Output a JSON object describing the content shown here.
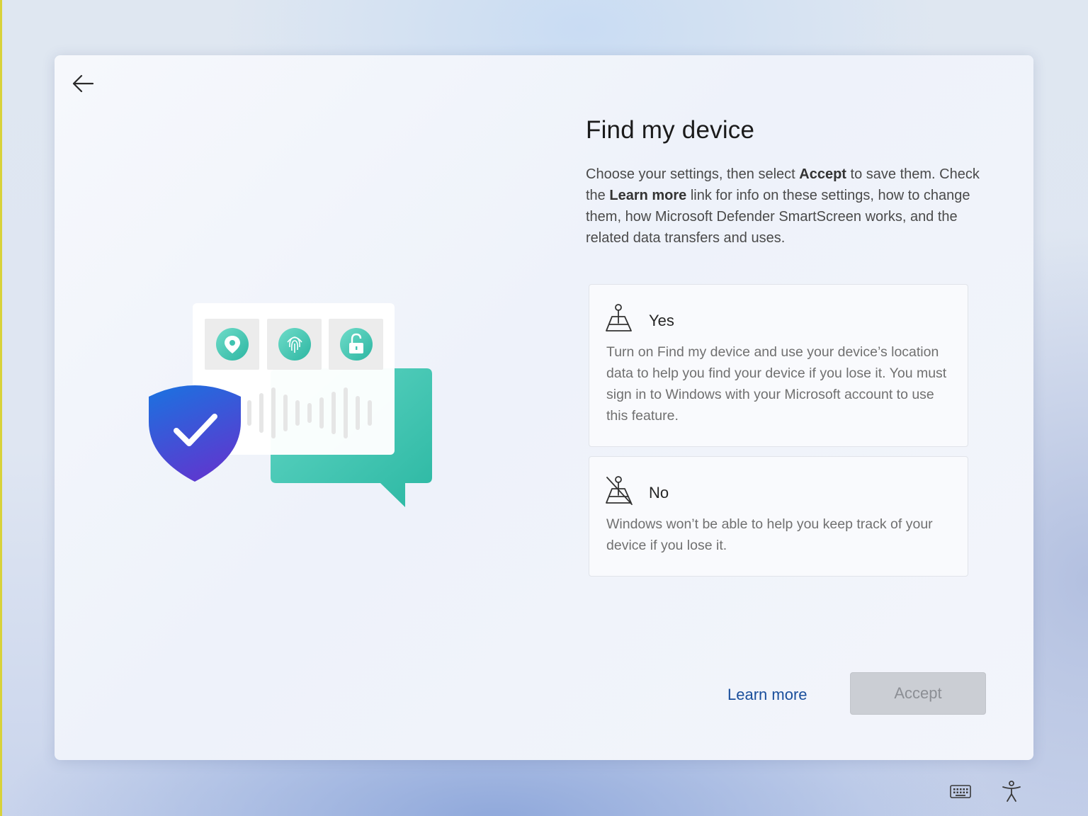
{
  "dialog": {
    "title": "Find my device",
    "description": {
      "p1": "Choose your settings, then select ",
      "accept_word": "Accept",
      "p2": " to save them. Check the ",
      "learn_more_word": "Learn more",
      "p3": " link for info on these settings, how to change them, how Microsoft Defender SmartScreen works, and the related data transfers and uses."
    },
    "options": [
      {
        "label": "Yes",
        "icon": "location-pin-icon",
        "description": "Turn on Find my device and use your device’s location data to help you find your device if you lose it. You must sign in to Windows with your Microsoft account to use this feature."
      },
      {
        "label": "No",
        "icon": "location-off-icon",
        "description": "Windows won’t be able to help you keep track of your device if you lose it."
      }
    ],
    "learn_more_label": "Learn more",
    "accept_label": "Accept",
    "accept_enabled": false
  },
  "taskbar": {
    "icons": [
      "keyboard-icon",
      "accessibility-icon"
    ]
  },
  "colors": {
    "link": "#1a4f9c",
    "accent_teal": "#3fc3b0",
    "shield_blue": "#2f5fd8"
  }
}
